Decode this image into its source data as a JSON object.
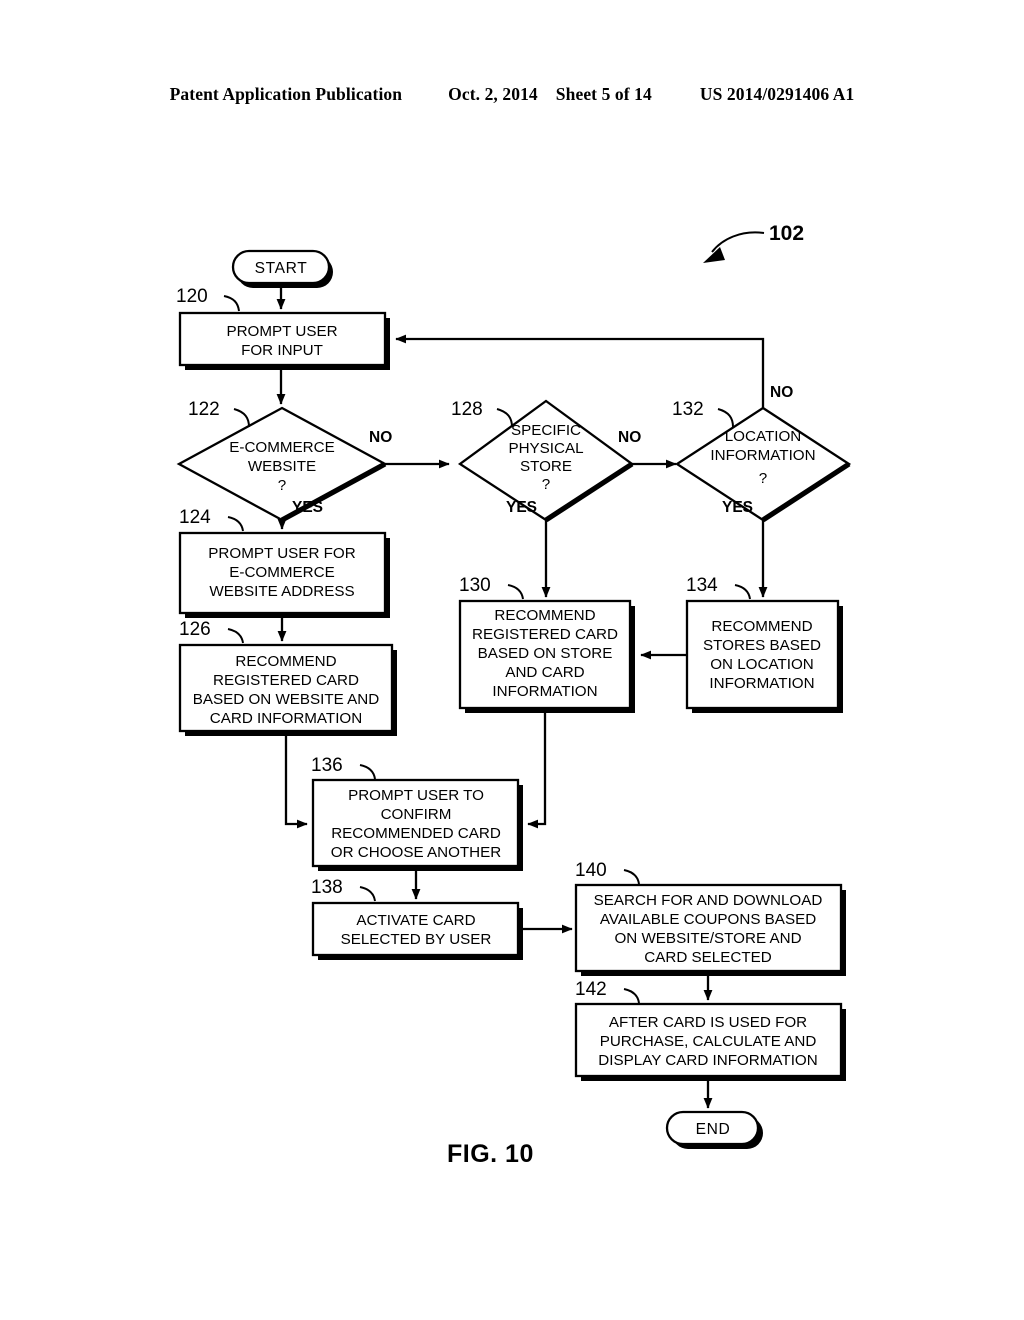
{
  "header": {
    "publication": "Patent Application Publication",
    "date": "Oct. 2, 2014",
    "sheet": "Sheet 5 of 14",
    "patent_number": "US 2014/0291406 A1"
  },
  "figure": {
    "caption": "FIG. 10",
    "diagram_reference": "102"
  },
  "nodes": {
    "start": {
      "ref": "",
      "label": "START"
    },
    "end": {
      "ref": "",
      "label": "END"
    },
    "n120": {
      "ref": "120",
      "lines": [
        "PROMPT USER",
        "FOR INPUT"
      ]
    },
    "n122": {
      "ref": "122",
      "lines": [
        "E-COMMERCE",
        "WEBSITE",
        "?"
      ]
    },
    "n124": {
      "ref": "124",
      "lines": [
        "PROMPT USER FOR",
        "E-COMMERCE",
        "WEBSITE ADDRESS"
      ]
    },
    "n126": {
      "ref": "126",
      "lines": [
        "RECOMMEND",
        "REGISTERED CARD",
        "BASED ON WEBSITE AND",
        "CARD INFORMATION"
      ]
    },
    "n128": {
      "ref": "128",
      "lines": [
        "SPECIFIC",
        "PHYSICAL",
        "STORE",
        "?"
      ]
    },
    "n130": {
      "ref": "130",
      "lines": [
        "RECOMMEND",
        "REGISTERED CARD",
        "BASED ON STORE",
        "AND CARD",
        "INFORMATION"
      ]
    },
    "n132": {
      "ref": "132",
      "lines": [
        "LOCATION",
        "INFORMATION",
        "?"
      ]
    },
    "n134": {
      "ref": "134",
      "lines": [
        "RECOMMEND",
        "STORES BASED",
        "ON LOCATION",
        "INFORMATION"
      ]
    },
    "n136": {
      "ref": "136",
      "lines": [
        "PROMPT USER TO",
        "CONFIRM",
        "RECOMMENDED CARD",
        "OR CHOOSE ANOTHER"
      ]
    },
    "n138": {
      "ref": "138",
      "lines": [
        "ACTIVATE CARD",
        "SELECTED BY USER"
      ]
    },
    "n140": {
      "ref": "140",
      "lines": [
        "SEARCH FOR AND DOWNLOAD",
        "AVAILABLE COUPONS BASED",
        "ON WEBSITE/STORE AND",
        "CARD SELECTED"
      ]
    },
    "n142": {
      "ref": "142",
      "lines": [
        "AFTER CARD IS USED FOR",
        "PURCHASE, CALCULATE AND",
        "DISPLAY CARD INFORMATION"
      ]
    }
  },
  "edge_labels": {
    "e122_no": "NO",
    "e122_yes": "YES",
    "e128_no": "NO",
    "e128_yes": "YES",
    "e132_no": "NO",
    "e132_yes": "YES"
  },
  "colors": {
    "ink": "#000000",
    "paper": "#ffffff"
  }
}
